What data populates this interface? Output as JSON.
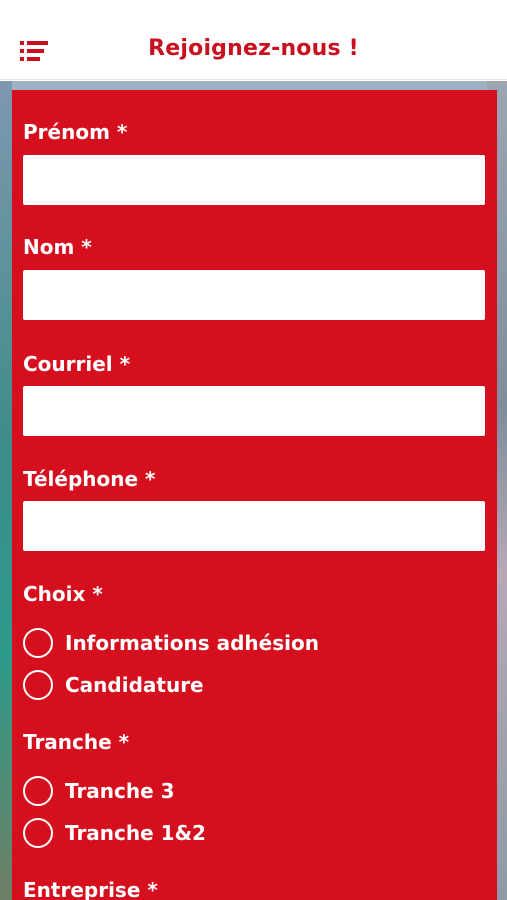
{
  "header": {
    "title": "Rejoignez-nous !"
  },
  "form": {
    "fields": [
      {
        "label": "Prénom *",
        "value": ""
      },
      {
        "label": "Nom *",
        "value": ""
      },
      {
        "label": "Courriel *",
        "value": ""
      },
      {
        "label": "Téléphone *",
        "value": ""
      }
    ],
    "choix": {
      "label": "Choix *",
      "options": [
        "Informations adhésion",
        "Candidature"
      ]
    },
    "tranche": {
      "label": "Tranche *",
      "options": [
        "Tranche 3",
        "Tranche 1&2"
      ]
    },
    "entreprise": {
      "label": "Entreprise *"
    }
  },
  "colors": {
    "accent": "#d50f1d",
    "title": "#c8101f"
  },
  "icons": [
    "menu-icon"
  ]
}
